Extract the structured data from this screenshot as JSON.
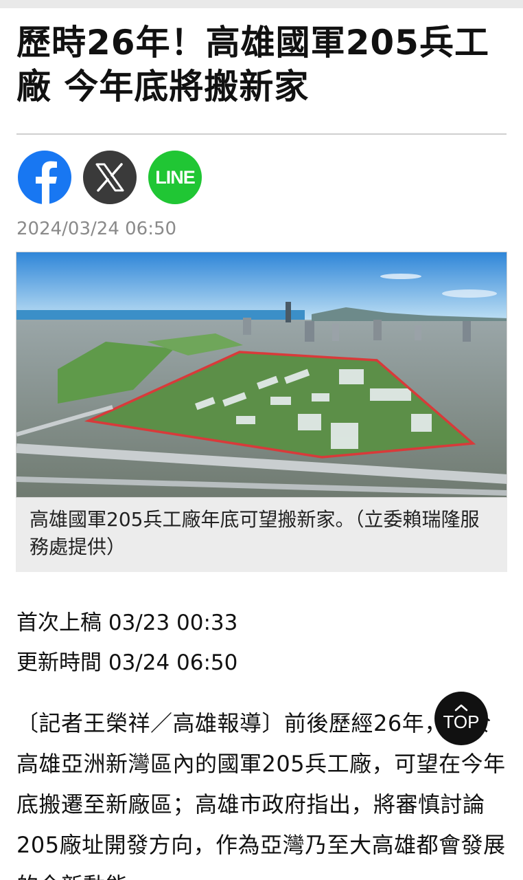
{
  "article": {
    "headline": "歷時26年！高雄國軍205兵工廠 今年底將搬新家",
    "date": "2024/03/24 06:50",
    "first_published": "首次上稿 03/23 00:33",
    "updated": "更新時間 03/24 06:50",
    "body": "〔記者王榮祥／高雄報導〕前後歷經26年，位於高雄亞洲新灣區內的國軍205兵工廠，可望在今年底搬遷至新廠區；高雄市政府指出，將審慎討論205廠址開發方向，作為亞灣乃至大高雄都會發展的全新動能。"
  },
  "share": {
    "line_label": "LINE",
    "icons": [
      "facebook-icon",
      "x-icon",
      "line-icon"
    ]
  },
  "photo": {
    "caption": "高雄國軍205兵工廠年底可望搬新家。（立委賴瑞隆服務處提供）"
  },
  "scroll_top": {
    "label": "TOP"
  },
  "colors": {
    "facebook": "#1877f2",
    "x": "#3a3a3a",
    "line": "#20c634",
    "site_outline": "#d83a3a"
  }
}
